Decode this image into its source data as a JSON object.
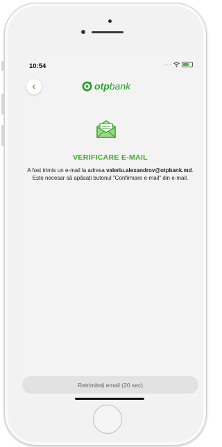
{
  "status_bar": {
    "time": "10:54",
    "signal": "....."
  },
  "header": {
    "back_icon": "chevron-left-icon",
    "logo_bold": "otp",
    "logo_light": "bank"
  },
  "content": {
    "icon": "envelope-icon",
    "title": "VERIFICARE E-MAIL",
    "message_before": "A fost trimis un e-mail la adresa ",
    "email": "valeriu.alexandrov@otpbank.md",
    "message_after": ". Este necesar să apăsați butonul \"Confirmare e-mail\" din e-mail."
  },
  "footer": {
    "resend_label": "Retrimiteți email (20 sec)"
  },
  "colors": {
    "accent": "#43a630",
    "button_bg": "#e2e2e2"
  }
}
